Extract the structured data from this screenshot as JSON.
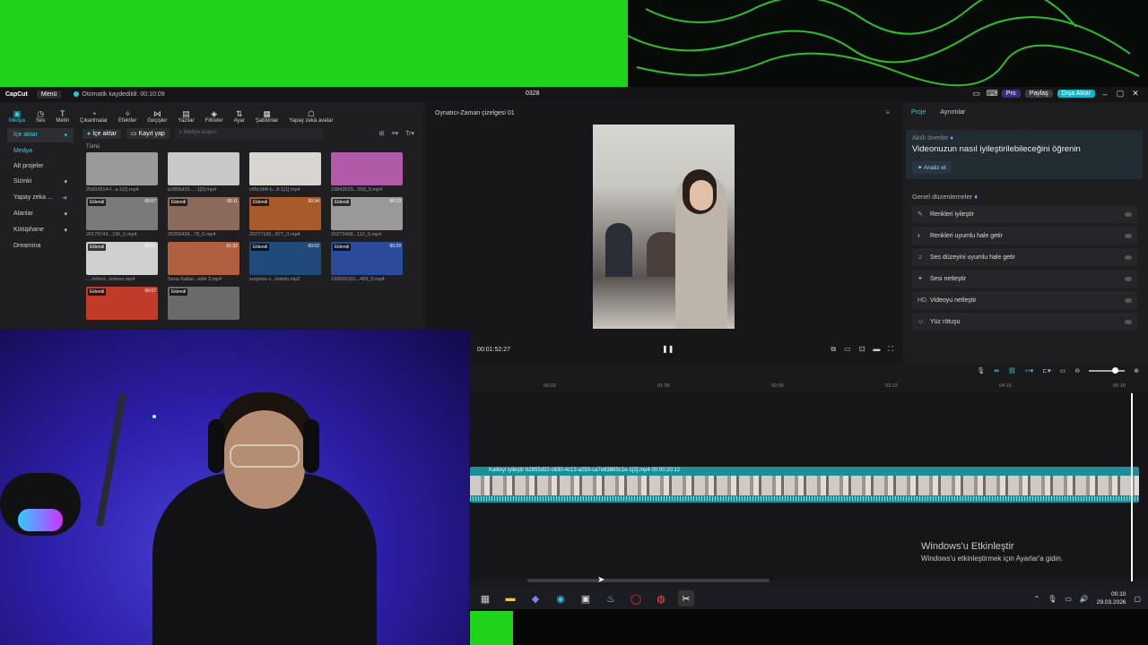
{
  "titlebar": {
    "logo": "CapCut",
    "menu": "Menü",
    "autosave": "Otomatik kaydedildi: 00:10:09",
    "title": "0328",
    "pro": "Pro",
    "share": "Paylaş",
    "export": "Dışa Aktar"
  },
  "toolbar": {
    "items": [
      "Medya",
      "Ses",
      "Metin",
      "Çıkartmalar",
      "Efektler",
      "Geçişler",
      "Yazılar",
      "Filtreler",
      "Ayar",
      "Şablonlar",
      "Yapay zekâ avatar"
    ]
  },
  "sidebar": {
    "items": [
      "İçe aktar",
      "Medya",
      "Alt projeler",
      "Sizinki",
      "Yapay zeka ...",
      "Alanlar",
      "Kütüphane",
      "Dreamina"
    ]
  },
  "media": {
    "import": "İçe aktar",
    "record": "Kayıt yap",
    "search_placeholder": "Medya arayın",
    "all": "Tümü",
    "sort": "Tr",
    "thumbs": [
      {
        "name": "25892814-f...a-1[1].mp4",
        "badge": "",
        "dur": "",
        "color": "#9a9a9a"
      },
      {
        "name": "b2855d32-...-1[2].mp4",
        "badge": "",
        "dur": "",
        "color": "#c8c8c8"
      },
      {
        "name": "c65c0f4f-b...8-1[1].mp4",
        "badge": "",
        "dur": "",
        "color": "#d8d4d0"
      },
      {
        "name": "1984262S...969_0.mp4",
        "badge": "",
        "dur": "",
        "color": "#b05aa8"
      },
      {
        "name": "20176743...196_0.mp4",
        "badge": "Eklendi",
        "dur": "00:07",
        "color": "#7a7a7a"
      },
      {
        "name": "20259428...78_0.mp4",
        "badge": "Eklendi",
        "dur": "00:11",
        "color": "#8a6a58"
      },
      {
        "name": "20277165...877_0.mp4",
        "badge": "Eklendi",
        "dur": "00:34",
        "color": "#a85a2a"
      },
      {
        "name": "20273468...112_0.mp4",
        "badge": "Eklendi",
        "dur": "00:13",
        "color": "#9a9898"
      },
      {
        "name": "... #short...telmez.mp4",
        "badge": "Eklendi",
        "dur": "00:07",
        "color": "#d0d0d0"
      },
      {
        "name": "Sena Kabar...edik 2.mp4",
        "badge": "",
        "dur": "01:32",
        "color": "#b06040"
      },
      {
        "name": "surprise-s...botom.mp3",
        "badge": "Eklendi",
        "dur": "00:02",
        "color": "#1f4a7a"
      },
      {
        "name": "199926331...499_0.mp4",
        "badge": "Eklendi",
        "dur": "00:29",
        "color": "#2a4a9a"
      },
      {
        "name": "",
        "badge": "Eklendi",
        "dur": "00:07",
        "color": "#c23b2a"
      },
      {
        "name": "",
        "badge": "Eklendi",
        "dur": "",
        "color": "#6a6a6a"
      }
    ]
  },
  "player": {
    "title": "Oynatıcı-Zaman çizelgesi 01",
    "time": "00:01:52:27"
  },
  "right": {
    "tab_project": "Proje",
    "tab_details": "Ayrıntılar",
    "smart_title": "Akıllı öneriler",
    "smart_text": "Videonuzun nasıl iyileştirilebileceğini öğrenin",
    "analyze": "Analiz et",
    "general": "Genel düzenlemeler",
    "items": [
      {
        "icon": "✎",
        "label": "Renkleri iyileştir"
      },
      {
        "icon": "◐",
        "label": "Renkleri uyumlu hale getir"
      },
      {
        "icon": "♫",
        "label": "Ses düzeyini uyumlu hale getir"
      },
      {
        "icon": "✦",
        "label": "Sesi netleştir"
      },
      {
        "icon": "HD",
        "label": "Videoyu netleştir"
      },
      {
        "icon": "☺",
        "label": "Yüz rötuşu"
      }
    ]
  },
  "timeline": {
    "ticks": [
      "00:03",
      "01:06",
      "02:09",
      "03:12",
      "04:15",
      "05:18"
    ],
    "clip_label": "Kaliteyi iyileştir   b2855d32-c630-4c13-a293-ca7e63863c1e-1[2].mp4   00:00:20:12"
  },
  "watermark": {
    "title": "Windows'u Etkinleştir",
    "subtitle": "Windows'u etkinleştirmek için Ayarlar'a gidin."
  },
  "taskbar": {
    "time": "00:10",
    "date": "29.03.2026"
  }
}
